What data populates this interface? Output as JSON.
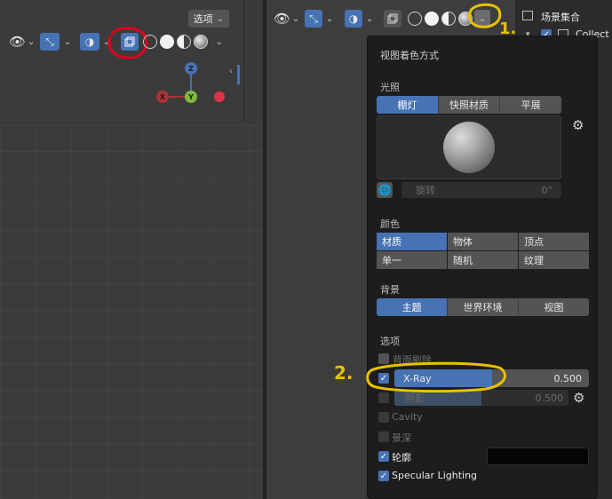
{
  "left_viewport": {
    "options_label": "选项",
    "axis_z": "Z",
    "axis_x": "X",
    "axis_y": "Y"
  },
  "outliner": {
    "scene_collection": "场景集合",
    "collection": "Collect"
  },
  "popover": {
    "title": "视图着色方式",
    "lighting": {
      "label": "光照",
      "options": [
        "棚灯",
        "快照材质",
        "平展"
      ],
      "selected": "棚灯",
      "rotation_label": "旋转",
      "rotation_value": "0°"
    },
    "color": {
      "label": "颜色",
      "options": [
        "材质",
        "物体",
        "顶点",
        "单一",
        "随机",
        "纹理"
      ],
      "selected": "材质"
    },
    "background": {
      "label": "背景",
      "options": [
        "主题",
        "世界环境",
        "视图"
      ],
      "selected": "主题"
    },
    "options": {
      "label": "选项",
      "backface_culling": "背面剔除",
      "xray_label": "X-Ray",
      "xray_value": "0.500",
      "xray_checked": true,
      "shadow_label": "阴影",
      "shadow_value": "0.500",
      "cavity_label": "Cavity",
      "dof_label": "景深",
      "outline_label": "轮廓",
      "outline_checked": true,
      "specular_label": "Specular Lighting",
      "specular_checked": true
    }
  },
  "annotations": {
    "step1": "1.",
    "step2": "2.",
    "color": "#e8c200",
    "highlight_color": "#e0001b"
  },
  "colors": {
    "accent": "#4772b3",
    "button": "#545454",
    "popover_bg": "#1d1d1d"
  }
}
